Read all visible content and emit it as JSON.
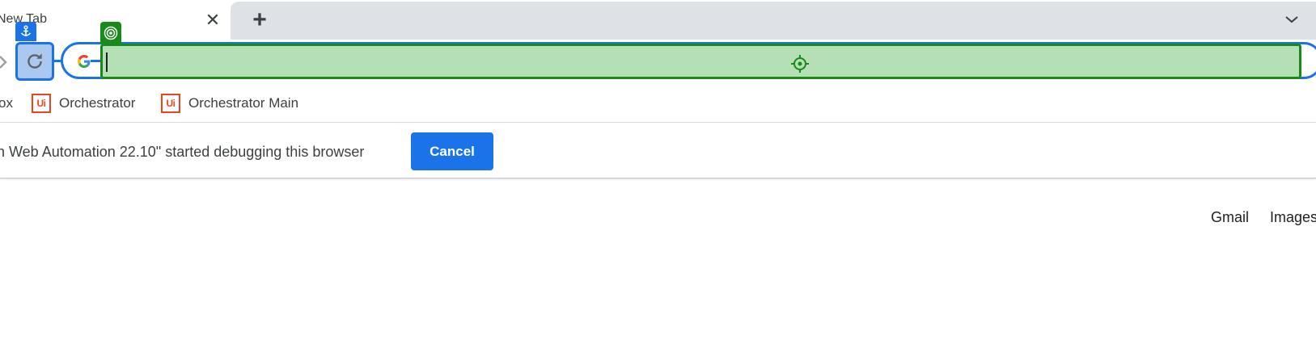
{
  "tab": {
    "title": "New Tab"
  },
  "tabstrip": {
    "new_tab": "+",
    "close": "✕"
  },
  "toolbar": {
    "reload_label": "Reload",
    "omnibox_value": ""
  },
  "bookmarks": {
    "partial_label": "ox",
    "items": [
      {
        "label": "Orchestrator",
        "logo": "Ui"
      },
      {
        "label": "Orchestrator Main",
        "logo": "Ui"
      }
    ]
  },
  "infobar": {
    "message": "n Web Automation 22.10\" started debugging this browser",
    "cancel_label": "Cancel"
  },
  "page": {
    "links": {
      "gmail": "Gmail",
      "images": "Images"
    }
  },
  "colors": {
    "accent": "#1a73e8",
    "target_green": "#188a18",
    "target_fill": "#b5dfb5",
    "uipath_orange": "#e8451b"
  }
}
